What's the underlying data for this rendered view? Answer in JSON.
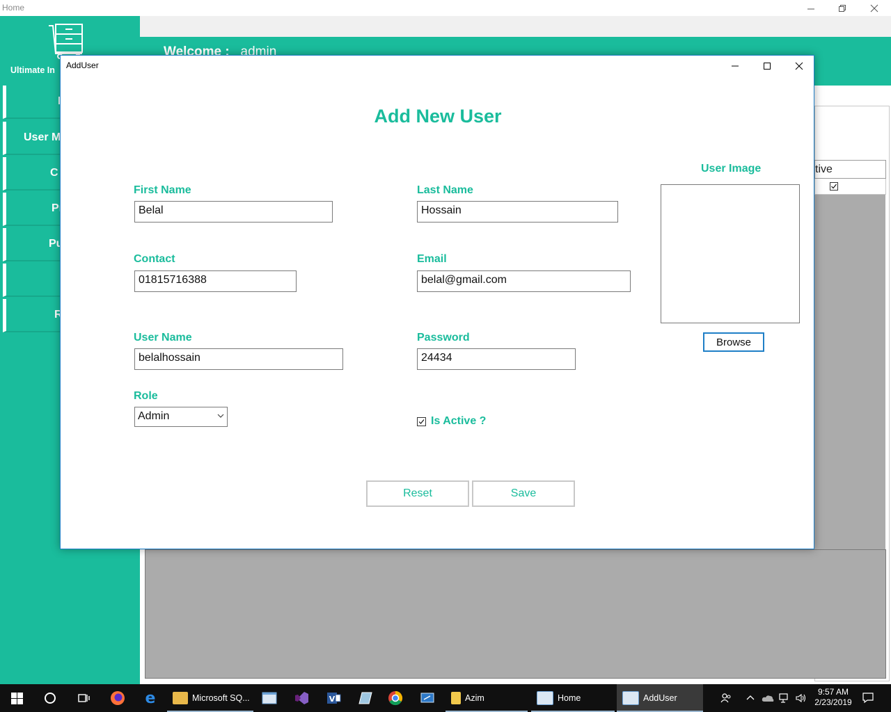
{
  "main_window": {
    "title": "Home",
    "brand": "Ultimate In",
    "welcome_label": "Welcome :",
    "welcome_user": "admin",
    "nav_items": [
      {
        "label": "I"
      },
      {
        "label": "User M"
      },
      {
        "label": "C"
      },
      {
        "label": "Pr"
      },
      {
        "label": "Pu"
      },
      {
        "label": ""
      },
      {
        "label": "R"
      }
    ],
    "grid": {
      "column_header": "tive",
      "checked": true
    }
  },
  "dialog": {
    "title": "AddUser",
    "heading": "Add New User",
    "fields": {
      "first_name": {
        "label": "First Name",
        "value": "Belal"
      },
      "last_name": {
        "label": "Last Name",
        "value": "Hossain"
      },
      "contact": {
        "label": "Contact",
        "value": "01815716388"
      },
      "email": {
        "label": "Email",
        "value": "belal@gmail.com"
      },
      "user_name": {
        "label": "User Name",
        "value": "belalhossain"
      },
      "password": {
        "label": "Password",
        "value": "24434"
      },
      "role": {
        "label": "Role",
        "value": "Admin"
      }
    },
    "is_active": {
      "label": "Is Active ?",
      "checked": true
    },
    "user_image_label": "User Image",
    "browse_label": "Browse",
    "reset_label": "Reset",
    "save_label": "Save"
  },
  "taskbar": {
    "apps": [
      {
        "label": "Microsoft SQ..."
      },
      {
        "label": "Azim"
      },
      {
        "label": "Home"
      },
      {
        "label": "AddUser"
      }
    ],
    "clock_time": "9:57 AM",
    "clock_date": "2/23/2019"
  },
  "colors": {
    "accent": "#1abc9c",
    "dialog_border": "#1f7fc7",
    "taskbar": "#101010",
    "grid_gray": "#ababab"
  }
}
